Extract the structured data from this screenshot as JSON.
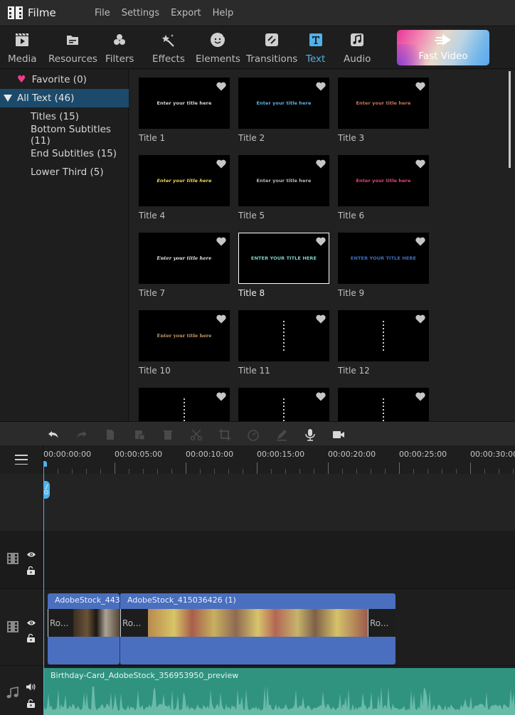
{
  "app": {
    "name": "Filme",
    "menu": [
      "File",
      "Settings",
      "Export",
      "Help"
    ]
  },
  "toolbar": {
    "tabs": [
      {
        "label": "Media",
        "icon": "media-icon"
      },
      {
        "label": "Resources",
        "icon": "resources-icon"
      },
      {
        "label": "Filters",
        "icon": "filters-icon"
      },
      {
        "label": "Effects",
        "icon": "effects-icon"
      },
      {
        "label": "Elements",
        "icon": "elements-icon"
      },
      {
        "label": "Transitions",
        "icon": "transitions-icon"
      },
      {
        "label": "Text",
        "icon": "text-icon",
        "active": true
      },
      {
        "label": "Audio",
        "icon": "audio-icon"
      }
    ],
    "fast_video_label": "Fast Video"
  },
  "categories": {
    "favorite": "Favorite (0)",
    "all_text": "All Text (46)",
    "items": [
      "Titles (15)",
      "Bottom Subtitles (11)",
      "End Subtitles (15)",
      "Lower Third (5)"
    ]
  },
  "grid": {
    "preview_text": "Enter your title here",
    "preview_text_caps": "ENTER YOUR TITLE HERE",
    "cards": [
      {
        "label": "Title 1",
        "color": "#d8d8d8"
      },
      {
        "label": "Title 2",
        "color": "#5ab4e6"
      },
      {
        "label": "Title 3",
        "color": "#c77a5e"
      },
      {
        "label": "Title 4",
        "color": "#f0d55c"
      },
      {
        "label": "Title 5",
        "color": "#b9b9b9"
      },
      {
        "label": "Title 6",
        "color": "#e0467f"
      },
      {
        "label": "Title 7",
        "color": "#f0f0f0"
      },
      {
        "label": "Title 8",
        "color": "#7ed0c6",
        "selected": true
      },
      {
        "label": "Title 9",
        "color": "#3e6ec4"
      },
      {
        "label": "Title 10",
        "color": "#d5a26a"
      },
      {
        "label": "Title 11",
        "color": "#cfcfcf"
      },
      {
        "label": "Title 12",
        "color": "#cfcfcf"
      },
      {
        "label": "",
        "color": "#cfcfcf"
      },
      {
        "label": "",
        "color": "#cfcfcf"
      },
      {
        "label": "",
        "color": "#cfcfcf"
      }
    ]
  },
  "edit_toolbar": {
    "buttons": [
      {
        "name": "undo",
        "enabled": true
      },
      {
        "name": "redo",
        "enabled": false
      },
      {
        "name": "copy",
        "enabled": false
      },
      {
        "name": "paste",
        "enabled": false
      },
      {
        "name": "delete",
        "enabled": false
      },
      {
        "name": "cut",
        "enabled": false
      },
      {
        "name": "crop",
        "enabled": false
      },
      {
        "name": "speed",
        "enabled": false
      },
      {
        "name": "edit",
        "enabled": false
      },
      {
        "name": "record-voice",
        "enabled": true
      },
      {
        "name": "record-video",
        "enabled": true
      }
    ]
  },
  "timeline": {
    "time_labels": [
      "00:00:00:00",
      "00:00:05:00",
      "00:00:10:00",
      "00:00:15:00",
      "00:00:20:00",
      "00:00:25:00",
      "00:00:30:00"
    ],
    "playhead": "00:00:00:00",
    "video_clips": [
      {
        "name": "AdobeStock_443...",
        "thumb_label": "Ro..."
      },
      {
        "name": "AdobeStock_415036426 (1)",
        "thumb_label": "Ro..."
      }
    ],
    "audio_clip": {
      "name": "Birthday-Card_AdobeStock_356953950_preview"
    }
  },
  "colors": {
    "accent": "#4eb2ea",
    "selected_category": "#1b4a6b",
    "video_clip": "#4a6fbf",
    "audio_clip": "#2f9380",
    "favorite_heart": "#ee3d8b"
  }
}
